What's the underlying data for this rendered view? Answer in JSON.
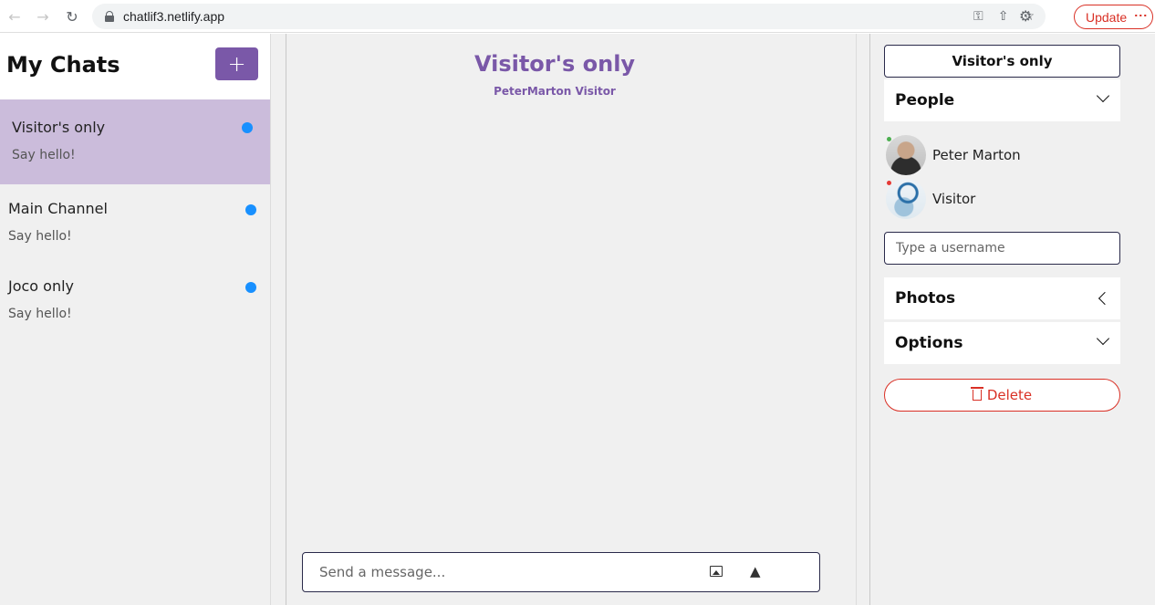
{
  "browser": {
    "url": "chatlif3.netlify.app",
    "update_label": "Update"
  },
  "sidebar": {
    "title": "My Chats",
    "new_chat_label": "+",
    "chats": [
      {
        "name": "Visitor's only",
        "preview": "Say hello!",
        "active": true
      },
      {
        "name": "Main Channel",
        "preview": "Say hello!",
        "active": false
      },
      {
        "name": "Joco only",
        "preview": "Say hello!",
        "active": false
      }
    ]
  },
  "feed": {
    "title": "Visitor's only",
    "subtitle": "PeterMarton Visitor",
    "composer_placeholder": "Send a message..."
  },
  "settings": {
    "title": "Visitor's only",
    "people_label": "People",
    "people": [
      {
        "name": "Peter Marton",
        "status_color": "#4caf50"
      },
      {
        "name": "Visitor",
        "status_color": "#e53935"
      }
    ],
    "username_placeholder": "Type a username",
    "photos_label": "Photos",
    "options_label": "Options",
    "delete_label": "Delete"
  },
  "colors": {
    "accent": "#7a58a8",
    "active_chat_bg": "#cbbcdb",
    "unread": "#1890ff",
    "danger": "#d93025"
  }
}
